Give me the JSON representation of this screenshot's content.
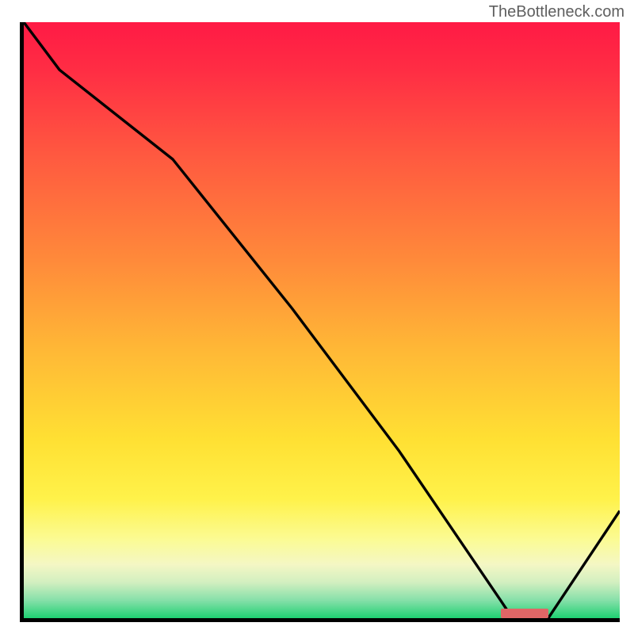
{
  "watermark": "TheBottleneck.com",
  "chart_data": {
    "type": "line",
    "title": "",
    "xlabel": "",
    "ylabel": "",
    "x": [
      0.0,
      0.06,
      0.25,
      0.45,
      0.63,
      0.8,
      0.82,
      0.88,
      1.0
    ],
    "values": [
      1.0,
      0.92,
      0.77,
      0.52,
      0.28,
      0.03,
      0.0,
      0.0,
      0.18
    ],
    "xlim": [
      0,
      1
    ],
    "ylim": [
      0,
      1
    ],
    "optimum_range_x": [
      0.8,
      0.88
    ],
    "gradient_stops": [
      {
        "pos": 0.0,
        "color": "#ff1a45"
      },
      {
        "pos": 0.4,
        "color": "#ff8a3a"
      },
      {
        "pos": 0.7,
        "color": "#ffe033"
      },
      {
        "pos": 0.9,
        "color": "#fbfb96"
      },
      {
        "pos": 1.0,
        "color": "#1fd072"
      }
    ]
  }
}
